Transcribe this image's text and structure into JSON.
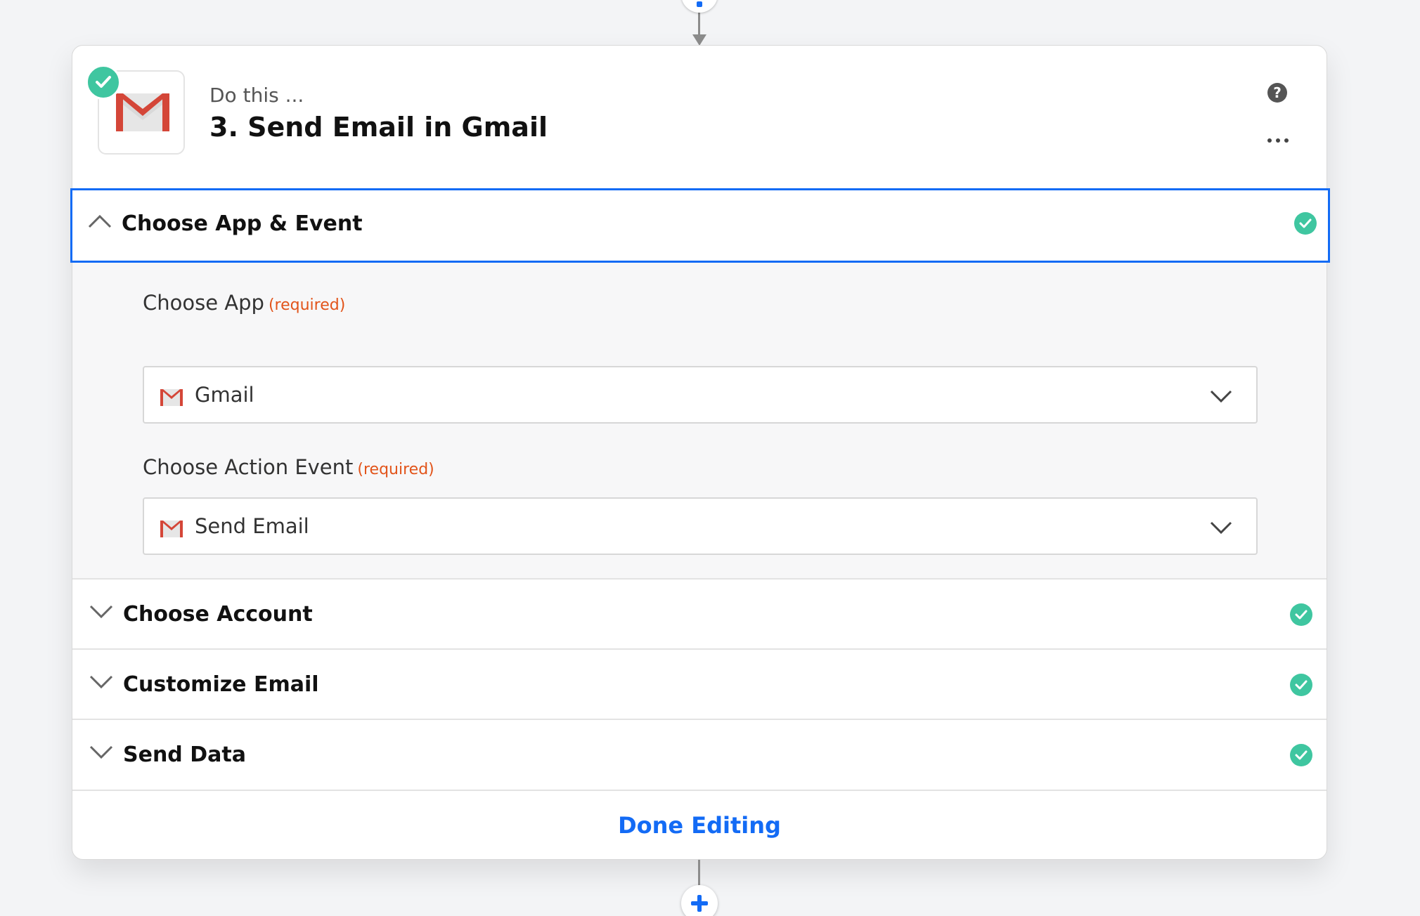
{
  "step": {
    "prefix": "Do this ...",
    "title": "3. Send Email in Gmail"
  },
  "sections": {
    "app_event": {
      "label": "Choose App & Event"
    },
    "account": {
      "label": "Choose Account"
    },
    "customize": {
      "label": "Customize Email"
    },
    "send_data": {
      "label": "Send Data"
    }
  },
  "fields": {
    "app": {
      "label": "Choose App",
      "required": "(required)",
      "value": "Gmail"
    },
    "event": {
      "label": "Choose Action Event",
      "required": "(required)",
      "value": "Send Email"
    }
  },
  "footer": {
    "done_label": "Done Editing"
  },
  "icons": {
    "app_logo": "gmail-icon",
    "status": "check-circle-icon",
    "help": "help-circle-icon",
    "more": "more-horizontal-icon",
    "expand": "chevron-down-icon",
    "collapse": "chevron-up-icon",
    "add": "plus-icon"
  },
  "colors": {
    "accent": "#136bf5",
    "success": "#3fc6a0",
    "required": "#e2541a",
    "gmail_red": "#d44638"
  }
}
